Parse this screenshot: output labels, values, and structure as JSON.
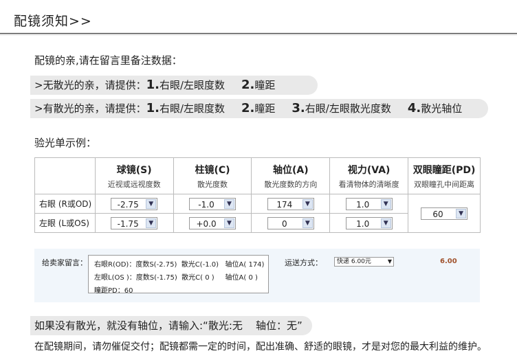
{
  "header": {
    "title": "配镜须知>>"
  },
  "intro": "配镜的亲,请在留言里备注数据：",
  "no_astig": {
    "prefix": ">无散光的亲，请提供：",
    "items": [
      {
        "num": "1.",
        "text": "右眼/左眼度数"
      },
      {
        "num": "2.",
        "text": "瞳距"
      }
    ]
  },
  "astig": {
    "prefix": ">有散光的亲，请提供：",
    "items": [
      {
        "num": "1.",
        "text": "右眼/左眼度数"
      },
      {
        "num": "2.",
        "text": "瞳距"
      },
      {
        "num": "3.",
        "text": "右眼/左眼散光度数"
      },
      {
        "num": "4.",
        "text": "散光轴位"
      }
    ]
  },
  "example_label": "验光单示例：",
  "table": {
    "columns": [
      {
        "title": "球镜(S)",
        "sub": "近视或远视度数"
      },
      {
        "title": "柱镜(C)",
        "sub": "散光度数"
      },
      {
        "title": "轴位(A)",
        "sub": "散光度数的方向"
      },
      {
        "title": "视力(VA)",
        "sub": "看清物体的清晰度"
      },
      {
        "title": "双眼瞳距(PD)",
        "sub": "双眼瞳孔中间距离"
      }
    ],
    "rows": [
      {
        "label": "右眼 (R或OD)",
        "sph": "-2.75",
        "cyl": "-1.0",
        "axis": "174",
        "va": "1.0"
      },
      {
        "label": "左眼 (L或OS)",
        "sph": "-1.75",
        "cyl": "+0.0",
        "axis": "0",
        "va": "1.0"
      }
    ],
    "pd": "60"
  },
  "notes": {
    "label": "给卖家留言：",
    "lines": [
      "右眼R(OD)：度数S(-2.75)  散光C(-1.0)   轴位A( 174)",
      "左眼L(OS )：度数S(-1.75)  散光C( 0 )     轴位A( 0 )",
      "瞳距PD：60"
    ],
    "ship_label": "运送方式：",
    "ship_value": "快递 6.00元",
    "price": "6.00"
  },
  "bottom_hint": "如果没有散光，就没有轴位，请输入:“散光:无    轴位：无”",
  "footer": "在配镜期间，请勿催促交付；配镜都需一定的时间，配出准确、舒适的眼镜，才是对您的最大利益的维护。",
  "colors": {
    "pill_bg": "#e9e9e9",
    "panel_bg": "#f1f6fb",
    "price": "#a0522d"
  }
}
